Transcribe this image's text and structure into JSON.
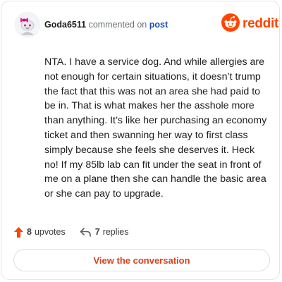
{
  "comment": {
    "username": "Goda6511",
    "action_text": "commented on",
    "post_link": "post",
    "body": "NTA. I have a service dog. And while allergies are not enough for certain situations, it doesn’t trump the fact that this was not an area she had paid to be in. That is what makes her the asshole more than anything. It’s like her purchasing an economy ticket and then swanning her way to first class simply because she feels she deserves it. Heck no! If my 85lb lab can fit under the seat in front of me on a plane then she can handle the basic area or she can pay to upgrade."
  },
  "logo": {
    "text": "reddit",
    "icon": "reddit-snoo-icon"
  },
  "avatar": {
    "icon": "snoo-avatar-pink-bow"
  },
  "stats": {
    "upvotes_count": "8",
    "upvotes_label": "upvotes",
    "replies_count": "7",
    "replies_label": "replies"
  },
  "cta": {
    "label": "View the conversation"
  },
  "colors": {
    "brand": "#ff4500",
    "link": "#1c4fb4",
    "cta_text": "#d8401b",
    "upvote": "#ff4500"
  }
}
